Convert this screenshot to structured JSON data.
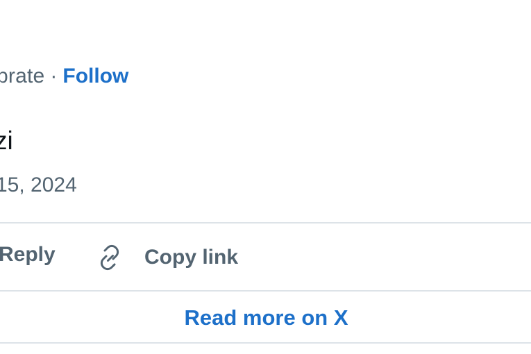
{
  "header": {
    "handle_fragment": "brate",
    "separator": "·",
    "follow_label": "Follow"
  },
  "tweet": {
    "text_fragment": "zi",
    "date_fragment": "15, 2024"
  },
  "actions": {
    "reply_label": "Reply",
    "copy_link_label": "Copy link",
    "copy_link_icon": "link-icon"
  },
  "footer": {
    "read_more_label": "Read more on X"
  },
  "colors": {
    "accent": "#1d70c9",
    "muted_text": "#536471",
    "primary_text": "#0f1419",
    "divider": "#dde3e8"
  }
}
